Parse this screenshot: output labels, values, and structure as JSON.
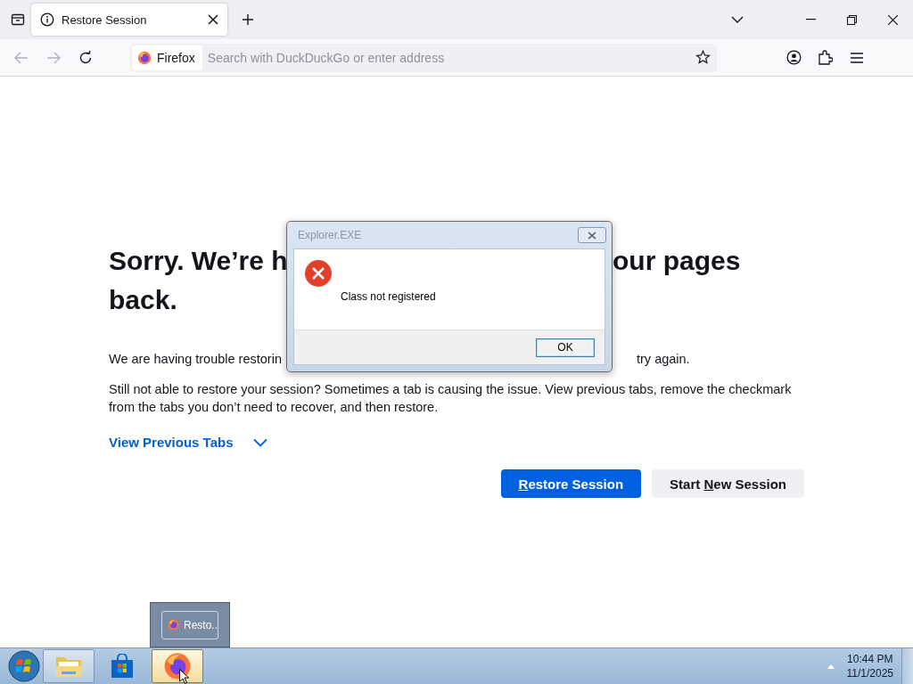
{
  "browser": {
    "tab": {
      "title": "Restore Session",
      "selected": true
    },
    "identity_label": "Firefox",
    "address_placeholder": "Search with DuckDuckGo or enter address"
  },
  "page": {
    "heading": {
      "left": "Sorry. We’re h",
      "right": "our pages",
      "line_2": "back."
    },
    "paragraph_1": {
      "left": "We are having trouble restorin",
      "right": "try again."
    },
    "paragraph_2": "Still not able to restore your session? Sometimes a tab is causing the issue. View previous tabs, remove the checkmark from the tabs you don’t need to recover, and then restore.",
    "view_link": "View Previous Tabs",
    "buttons": [
      {
        "kind": "primary",
        "key": "R",
        "after": "estore Session"
      },
      {
        "kind": "secondary",
        "before": "Start ",
        "key": "N",
        "after": "ew Session"
      }
    ]
  },
  "dialog": {
    "title": "Explorer.EXE",
    "message": "Class not registered",
    "button": "OK"
  },
  "taskbar": {
    "items": [
      {
        "kind": "explorer",
        "selected": false
      },
      {
        "kind": "store",
        "selected": false
      },
      {
        "kind": "firefox",
        "selected": true
      }
    ],
    "thumbnail_label": "Resto..",
    "time": "10:44 PM",
    "date": "11/1/2025"
  }
}
